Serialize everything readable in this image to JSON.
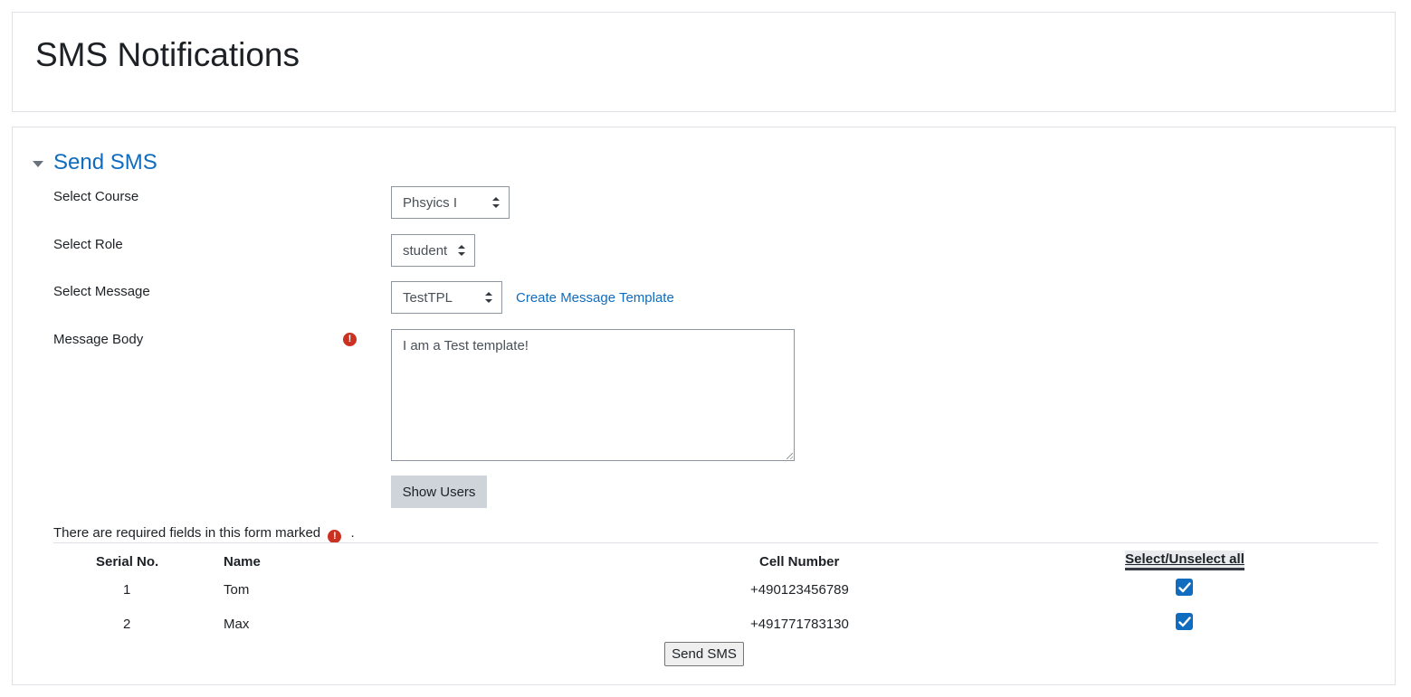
{
  "page": {
    "title": "SMS Notifications"
  },
  "section": {
    "title": "Send SMS"
  },
  "form": {
    "course": {
      "label": "Select Course",
      "value": "Phsyics I"
    },
    "role": {
      "label": "Select Role",
      "value": "student"
    },
    "message": {
      "label": "Select Message",
      "value": "TestTPL",
      "create_link": "Create Message Template"
    },
    "body": {
      "label": "Message Body",
      "value": "I am a Test template!"
    },
    "show_users_label": "Show Users",
    "required_note": "There are required fields in this form marked",
    "required_note_end": "."
  },
  "table": {
    "headers": {
      "serial": "Serial No.",
      "name": "Name",
      "cell": "Cell Number",
      "select_all": "Select/Unselect all"
    },
    "rows": [
      {
        "serial": "1",
        "name": "Tom",
        "cell": "+490123456789",
        "checked": true
      },
      {
        "serial": "2",
        "name": "Max",
        "cell": "+491771783130",
        "checked": true
      }
    ]
  },
  "send_label": "Send SMS",
  "colors": {
    "accent": "#0f6cbf",
    "required": "#ca3120"
  },
  "icons": {
    "section_toggle": "caret-down-icon",
    "required": "exclamation-circle-icon",
    "checkbox": "check-icon"
  }
}
